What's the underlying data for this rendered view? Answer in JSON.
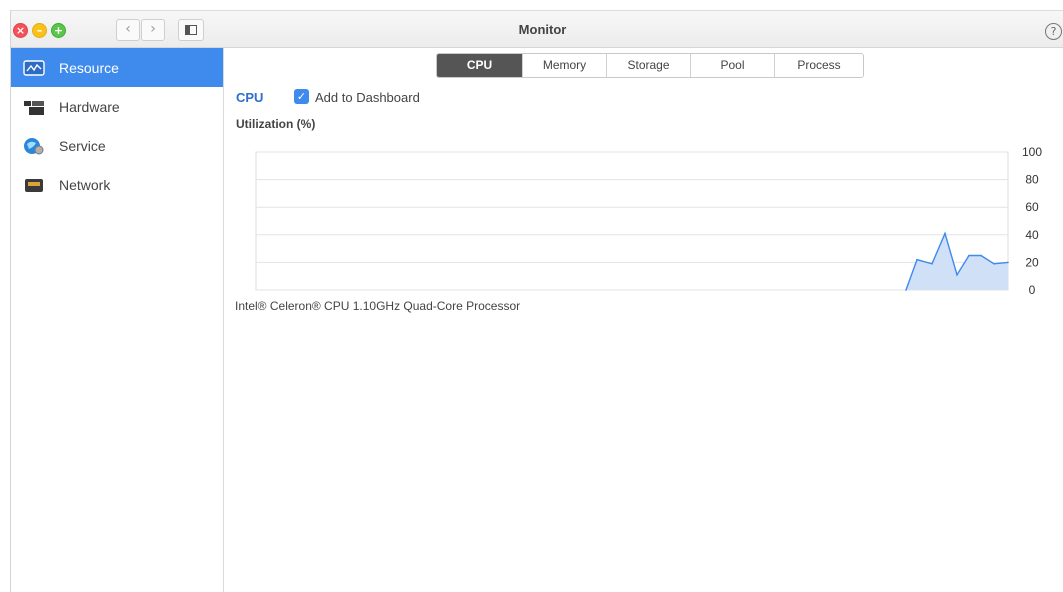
{
  "window": {
    "title": "Monitor",
    "help": "?"
  },
  "titlebar": {
    "close_glyph": "×",
    "min_glyph": "–",
    "max_glyph": "+",
    "back_glyph": "‹",
    "forward_glyph": "›"
  },
  "sidebar": {
    "items": [
      {
        "label": "Resource",
        "icon": "resource-icon",
        "active": true
      },
      {
        "label": "Hardware",
        "icon": "hardware-icon",
        "active": false
      },
      {
        "label": "Service",
        "icon": "service-icon",
        "active": false
      },
      {
        "label": "Network",
        "icon": "network-icon",
        "active": false
      }
    ]
  },
  "tabs": [
    {
      "label": "CPU",
      "active": true
    },
    {
      "label": "Memory",
      "active": false
    },
    {
      "label": "Storage",
      "active": false
    },
    {
      "label": "Pool",
      "active": false
    },
    {
      "label": "Process",
      "active": false
    }
  ],
  "main": {
    "section_title": "CPU",
    "add_to_dashboard": {
      "label": "Add to Dashboard",
      "checked": true,
      "check_glyph": "✓"
    },
    "chart_title": "Utilization (%)",
    "processor": "Intel® Celeron® CPU 1.10GHz Quad-Core Processor"
  },
  "colors": {
    "accent": "#3f8aed",
    "active_tab": "#555555",
    "line": "#3f8aed",
    "area_fill": "#cfe0f7"
  },
  "chart_data": {
    "type": "area",
    "title": "Utilization (%)",
    "ylim": [
      0,
      100
    ],
    "yticks": [
      0,
      20,
      40,
      60,
      80,
      100
    ],
    "y_axis_position": "right",
    "grid": true,
    "series": [
      {
        "values": [
          0,
          22,
          19,
          41,
          11,
          25,
          25,
          19,
          20
        ]
      }
    ]
  }
}
